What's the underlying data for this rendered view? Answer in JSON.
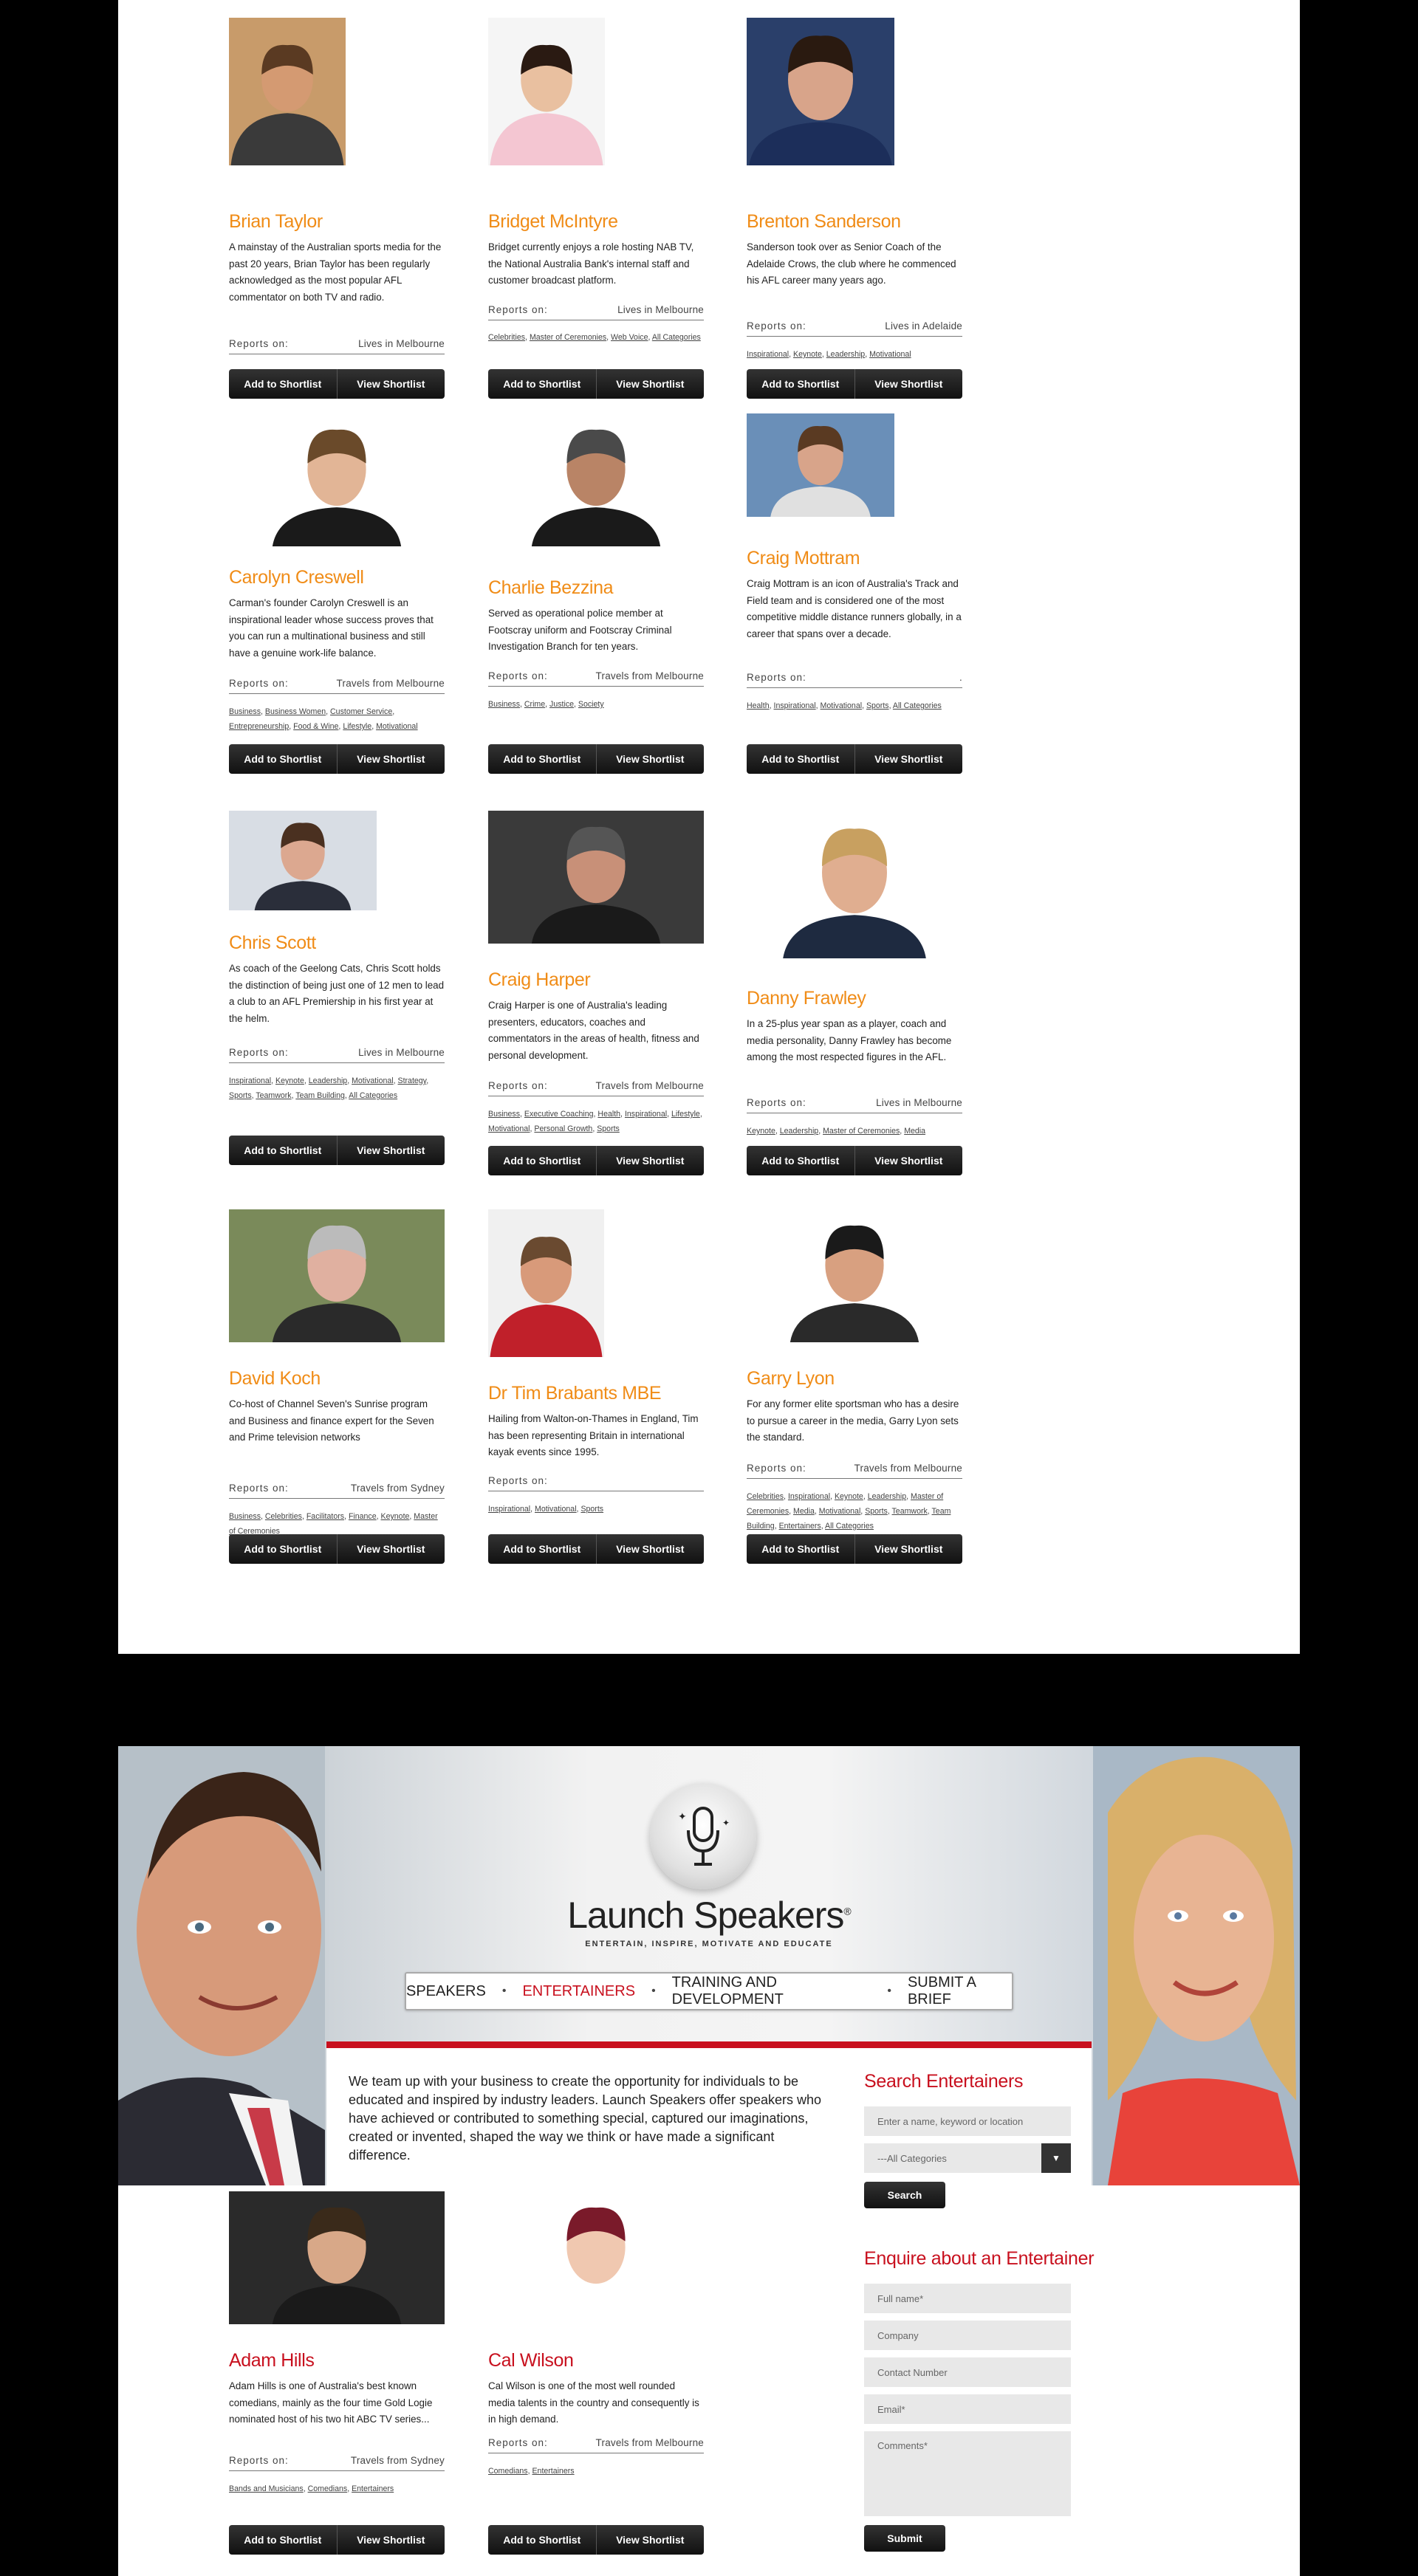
{
  "buttons": {
    "add_shortlist": "Add to Shortlist",
    "view_shortlist": "View Shortlist"
  },
  "reports_label": "Reports on:",
  "speakers": [
    {
      "name": "Brian Taylor",
      "desc": "A mainstay of the Australian sports media for the past 20 years, Brian Taylor has been regularly acknowledged as the most popular AFL commentator on both TV and radio.",
      "location": "Lives in Melbourne",
      "categories": []
    },
    {
      "name": "Bridget McIntyre",
      "desc": "Bridget currently enjoys a role hosting NAB TV, the National Australia Bank's internal staff and customer broadcast platform.",
      "location": "Lives in Melbourne",
      "categories": [
        "Celebrities",
        "Master of Ceremonies",
        "Web Voice",
        "All Categories"
      ]
    },
    {
      "name": "Brenton Sanderson",
      "desc": "Sanderson took over as Senior Coach of the Adelaide Crows, the club where he commenced his AFL career many years ago.",
      "location": "Lives in Adelaide",
      "categories": [
        "Inspirational",
        "Keynote",
        "Leadership",
        "Motivational"
      ]
    },
    {
      "name": "Carolyn Creswell",
      "desc": "Carman's founder Carolyn Creswell is an inspirational leader whose success proves that you can run a multinational business and still have a genuine work-life balance.",
      "location": "Travels from Melbourne",
      "categories": [
        "Business",
        "Business Women",
        "Customer Service",
        "Entrepreneurship",
        "Food & Wine",
        "Lifestyle",
        "Motivational"
      ]
    },
    {
      "name": "Charlie Bezzina",
      "desc": "Served as operational police member at Footscray uniform and Footscray Criminal Investigation Branch for ten years.",
      "location": "Travels from Melbourne",
      "categories": [
        "Business",
        "Crime",
        "Justice",
        "Society"
      ]
    },
    {
      "name": "Craig Mottram",
      "desc": "Craig Mottram is an icon of Australia's Track and Field team and is considered one of the most competitive middle distance runners globally, in a career that spans over a decade.",
      "location": ".",
      "categories": [
        "Health",
        "Inspirational",
        "Motivational",
        "Sports",
        "All Categories"
      ]
    },
    {
      "name": "Chris Scott",
      "desc": "As coach of the Geelong Cats, Chris Scott holds the distinction of being just one of 12 men to lead a club to an AFL Premiership in his first year at the helm.",
      "location": "Lives in Melbourne",
      "categories": [
        "Inspirational",
        "Keynote",
        "Leadership",
        "Motivational",
        "Strategy",
        "Sports",
        "Teamwork",
        "Team Building",
        "All Categories"
      ]
    },
    {
      "name": "Craig Harper",
      "desc": "Craig Harper is one of Australia's leading presenters, educators, coaches and commentators in the areas of health, fitness and personal development.",
      "location": "Travels from Melbourne",
      "categories": [
        "Business",
        "Executive Coaching",
        "Health",
        "Inspirational",
        "Lifestyle",
        "Motivational",
        "Personal Growth",
        "Sports"
      ]
    },
    {
      "name": "Danny Frawley",
      "desc": "In a 25-plus year span as a player, coach and media personality, Danny Frawley has become among the most respected figures in the AFL.",
      "location": "Lives in Melbourne",
      "categories": [
        "Keynote",
        "Leadership",
        "Master of Ceremonies",
        "Media"
      ]
    },
    {
      "name": "David Koch",
      "desc": "Co-host of Channel Seven's Sunrise program and Business and finance expert for the Seven and Prime television networks",
      "location": "Travels from Sydney",
      "categories": [
        "Business",
        "Celebrities",
        "Facilitators",
        "Finance",
        "Keynote",
        "Master of Ceremonies"
      ]
    },
    {
      "name": "Dr Tim Brabants MBE",
      "desc": "Hailing from Walton-on-Thames in England, Tim has been representing Britain in international kayak events since 1995.",
      "location": "",
      "categories": [
        "Inspirational",
        "Motivational",
        "Sports"
      ]
    },
    {
      "name": "Garry Lyon",
      "desc": "For any former elite sportsman who has a desire to pursue a career in the media, Garry Lyon sets the standard.",
      "location": "Travels from Melbourne",
      "categories": [
        "Celebrities",
        "Inspirational",
        "Keynote",
        "Leadership",
        "Master of Ceremonies",
        "Media",
        "Motivational",
        "Sports",
        "Teamwork",
        "Team Building",
        "Entertainers",
        "All Categories"
      ]
    }
  ],
  "banner": {
    "logo": "Launch Speakers",
    "registered": "®",
    "tagline": "ENTERTAIN, INSPIRE, MOTIVATE AND EDUCATE",
    "nav": [
      {
        "label": "SPEAKERS",
        "active": false
      },
      {
        "label": "ENTERTAINERS",
        "active": true
      },
      {
        "label": "TRAINING AND DEVELOPMENT",
        "active": false
      },
      {
        "label": "SUBMIT A BRIEF",
        "active": false
      }
    ],
    "nav_sep": "•",
    "intro": "We team up with your business to create the opportunity for individuals to be educated and inspired by industry leaders. Launch Speakers offer speakers who have achieved or contributed to something special, captured our imaginations, created or invented, shaped the way we think or have made a significant difference."
  },
  "sidebar": {
    "search_title": "Search Entertainers",
    "search_placeholder": "Enter a name, keyword or location",
    "category_select": "---All Categories",
    "search_button": "Search",
    "enquire_title": "Enquire about an Entertainer",
    "fields": [
      "Full name*",
      "Company",
      "Contact Number",
      "Email*",
      "Comments*"
    ],
    "submit_button": "Submit"
  },
  "entertainers": [
    {
      "name": "Adam Hills",
      "desc": "Adam Hills is one of Australia's best known comedians, mainly as the four time Gold Logie nominated host of his two hit ABC TV series...",
      "location": "Travels from Sydney",
      "categories": [
        "Bands and Musicians",
        "Comedians",
        "Entertainers"
      ]
    },
    {
      "name": "Cal Wilson",
      "desc": "Cal Wilson is one of the most well rounded media talents in the country and consequently is in high demand.",
      "location": "Travels from Melbourne",
      "categories": [
        "Comedians",
        "Entertainers"
      ]
    }
  ],
  "colors": {
    "name_orange": "#f08c17",
    "brand_red": "#c8101e",
    "button_dark": "#1a1a1a"
  }
}
